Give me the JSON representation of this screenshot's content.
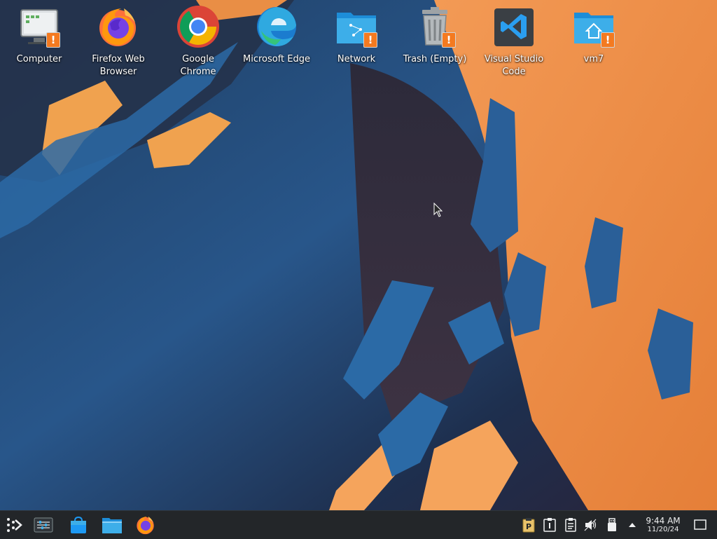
{
  "desktop": {
    "icons": [
      {
        "label": "Computer",
        "icon": "computer-icon",
        "warning": "!"
      },
      {
        "label": "Firefox Web Browser",
        "icon": "firefox-icon"
      },
      {
        "label": "Google Chrome",
        "icon": "chrome-icon"
      },
      {
        "label": "Microsoft Edge",
        "icon": "edge-icon"
      },
      {
        "label": "Network",
        "icon": "network-folder-icon",
        "warning": "!"
      },
      {
        "label": "Trash (Empty)",
        "icon": "trash-icon",
        "warning": "!"
      },
      {
        "label": "Visual Studio Code",
        "icon": "vscode-icon"
      },
      {
        "label": "vm7",
        "icon": "home-folder-icon",
        "warning": "!"
      }
    ]
  },
  "taskbar": {
    "launchers": [
      {
        "icon": "application-launcher-icon"
      },
      {
        "icon": "system-settings-icon"
      },
      {
        "icon": "discover-store-icon"
      },
      {
        "icon": "file-manager-icon"
      },
      {
        "icon": "firefox-icon"
      }
    ],
    "tray": [
      {
        "icon": "clipboard-manager-icon"
      },
      {
        "icon": "notes-icon"
      },
      {
        "icon": "clipboard-icon"
      },
      {
        "icon": "volume-muted-icon"
      },
      {
        "icon": "usb-device-icon"
      },
      {
        "icon": "show-hidden-tray-icon"
      }
    ],
    "clock": {
      "time": "9:44 AM",
      "date": "11/20/24"
    },
    "show_desktop_icon": "show-desktop-icon"
  },
  "colors": {
    "taskbar_bg": "#232629",
    "wallpaper_orange": "#f08d44",
    "wallpaper_blue": "#2c6ba6",
    "warning_badge": "#f47a20"
  }
}
